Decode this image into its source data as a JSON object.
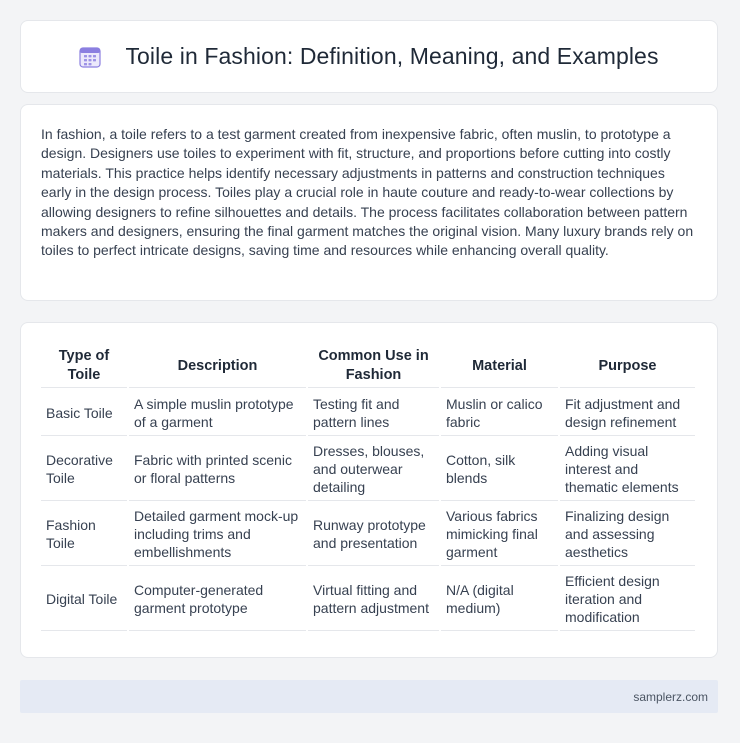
{
  "header": {
    "title": "Toile in Fashion: Definition, Meaning, and Examples",
    "icon": "calendar-icon"
  },
  "intro": {
    "text": "In fashion, a toile refers to a test garment created from inexpensive fabric, often muslin, to prototype a design. Designers use toiles to experiment with fit, structure, and proportions before cutting into costly materials. This practice helps identify necessary adjustments in patterns and construction techniques early in the design process. Toiles play a crucial role in haute couture and ready-to-wear collections by allowing designers to refine silhouettes and details. The process facilitates collaboration between pattern makers and designers, ensuring the final garment matches the original vision. Many luxury brands rely on toiles to perfect intricate designs, saving time and resources while enhancing overall quality."
  },
  "table": {
    "headers": [
      "Type of Toile",
      "Description",
      "Common Use in Fashion",
      "Material",
      "Purpose"
    ],
    "rows": [
      [
        "Basic Toile",
        "A simple muslin prototype of a garment",
        "Testing fit and pattern lines",
        "Muslin or calico fabric",
        "Fit adjustment and design refinement"
      ],
      [
        "Decorative Toile",
        "Fabric with printed scenic or floral patterns",
        "Dresses, blouses, and outerwear detailing",
        "Cotton, silk blends",
        "Adding visual interest and thematic elements"
      ],
      [
        "Fashion Toile",
        "Detailed garment mock-up including trims and embellishments",
        "Runway prototype and presentation",
        "Various fabrics mimicking final garment",
        "Finalizing design and assessing aesthetics"
      ],
      [
        "Digital Toile",
        "Computer-generated garment prototype",
        "Virtual fitting and pattern adjustment",
        "N/A (digital medium)",
        "Efficient design iteration and modification"
      ]
    ]
  },
  "footer": {
    "site": "samplerz.com"
  },
  "colors": {
    "background": "#f3f4f6",
    "card": "#ffffff",
    "footer_bg": "#e5eaf4",
    "icon_accent": "#7c6fd6"
  }
}
